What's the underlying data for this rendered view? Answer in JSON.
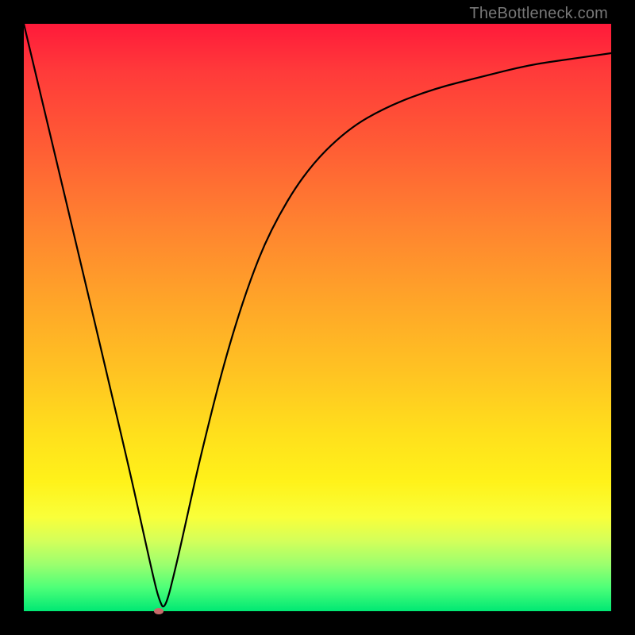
{
  "watermark": "TheBottleneck.com",
  "colors": {
    "frame": "#000000",
    "gradient_top": "#ff1a3a",
    "gradient_bottom": "#00e874",
    "curve": "#000000",
    "marker": "#c76a6a",
    "watermark_text": "#777777"
  },
  "chart_data": {
    "type": "line",
    "title": "",
    "xlabel": "",
    "ylabel": "",
    "xlim": [
      0,
      100
    ],
    "ylim": [
      0,
      100
    ],
    "grid": false,
    "legend": false,
    "series": [
      {
        "name": "bottleneck-curve",
        "x": [
          0,
          5,
          10,
          14,
          18,
          20,
          22,
          23,
          24,
          26,
          28,
          30,
          34,
          38,
          42,
          48,
          55,
          62,
          70,
          78,
          86,
          93,
          100
        ],
        "values": [
          100,
          79,
          58,
          41,
          24,
          15,
          6,
          2,
          0,
          8,
          17,
          26,
          42,
          55,
          65,
          75,
          82,
          86,
          89,
          91,
          93,
          94,
          95
        ]
      }
    ],
    "annotations": [
      {
        "name": "minimum-marker",
        "x": 23,
        "y": 0
      }
    ]
  }
}
